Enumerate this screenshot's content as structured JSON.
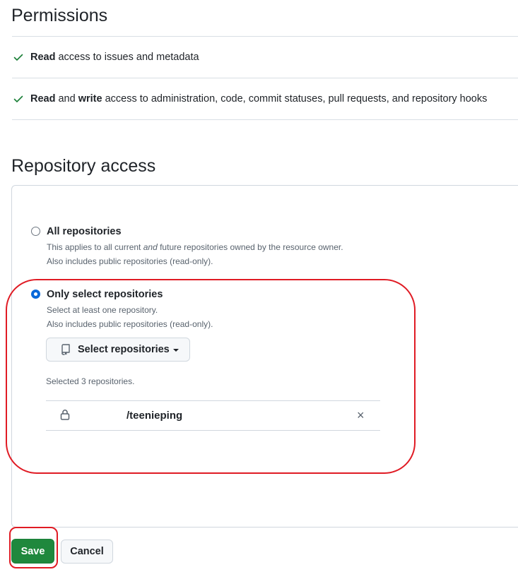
{
  "permissions": {
    "title": "Permissions",
    "items": [
      {
        "icon": "check-icon",
        "bold1": "Read",
        "mid": "",
        "bold2": "",
        "rest": " access to issues and metadata"
      },
      {
        "icon": "check-icon",
        "bold1": "Read",
        "mid": " and ",
        "bold2": "write",
        "rest": " access to administration, code, commit statuses, pull requests, and repository hooks"
      }
    ],
    "check_color": "#1a7f37"
  },
  "repo_access": {
    "title": "Repository access",
    "all": {
      "label": "All repositories",
      "note1_a": "This applies to all current ",
      "note1_em": "and",
      "note1_b": " future repositories owned by the resource owner.",
      "note2": "Also includes public repositories (read-only).",
      "selected": false
    },
    "select": {
      "label": "Only select repositories",
      "note1": "Select at least one repository.",
      "note2": "Also includes public repositories (read-only).",
      "selected": true,
      "button_label": "Select repositories",
      "count_text": "Selected 3 repositories.",
      "repos": [
        {
          "name": "/teenieping",
          "icon": "lock-icon",
          "remove_icon": "close-icon",
          "remove_glyph": "×"
        }
      ]
    }
  },
  "actions": {
    "save_label": "Save",
    "cancel_label": "Cancel"
  },
  "colors": {
    "primary": "#1f883d",
    "radio_selected": "#0969da",
    "annotation": "#e01b24"
  }
}
